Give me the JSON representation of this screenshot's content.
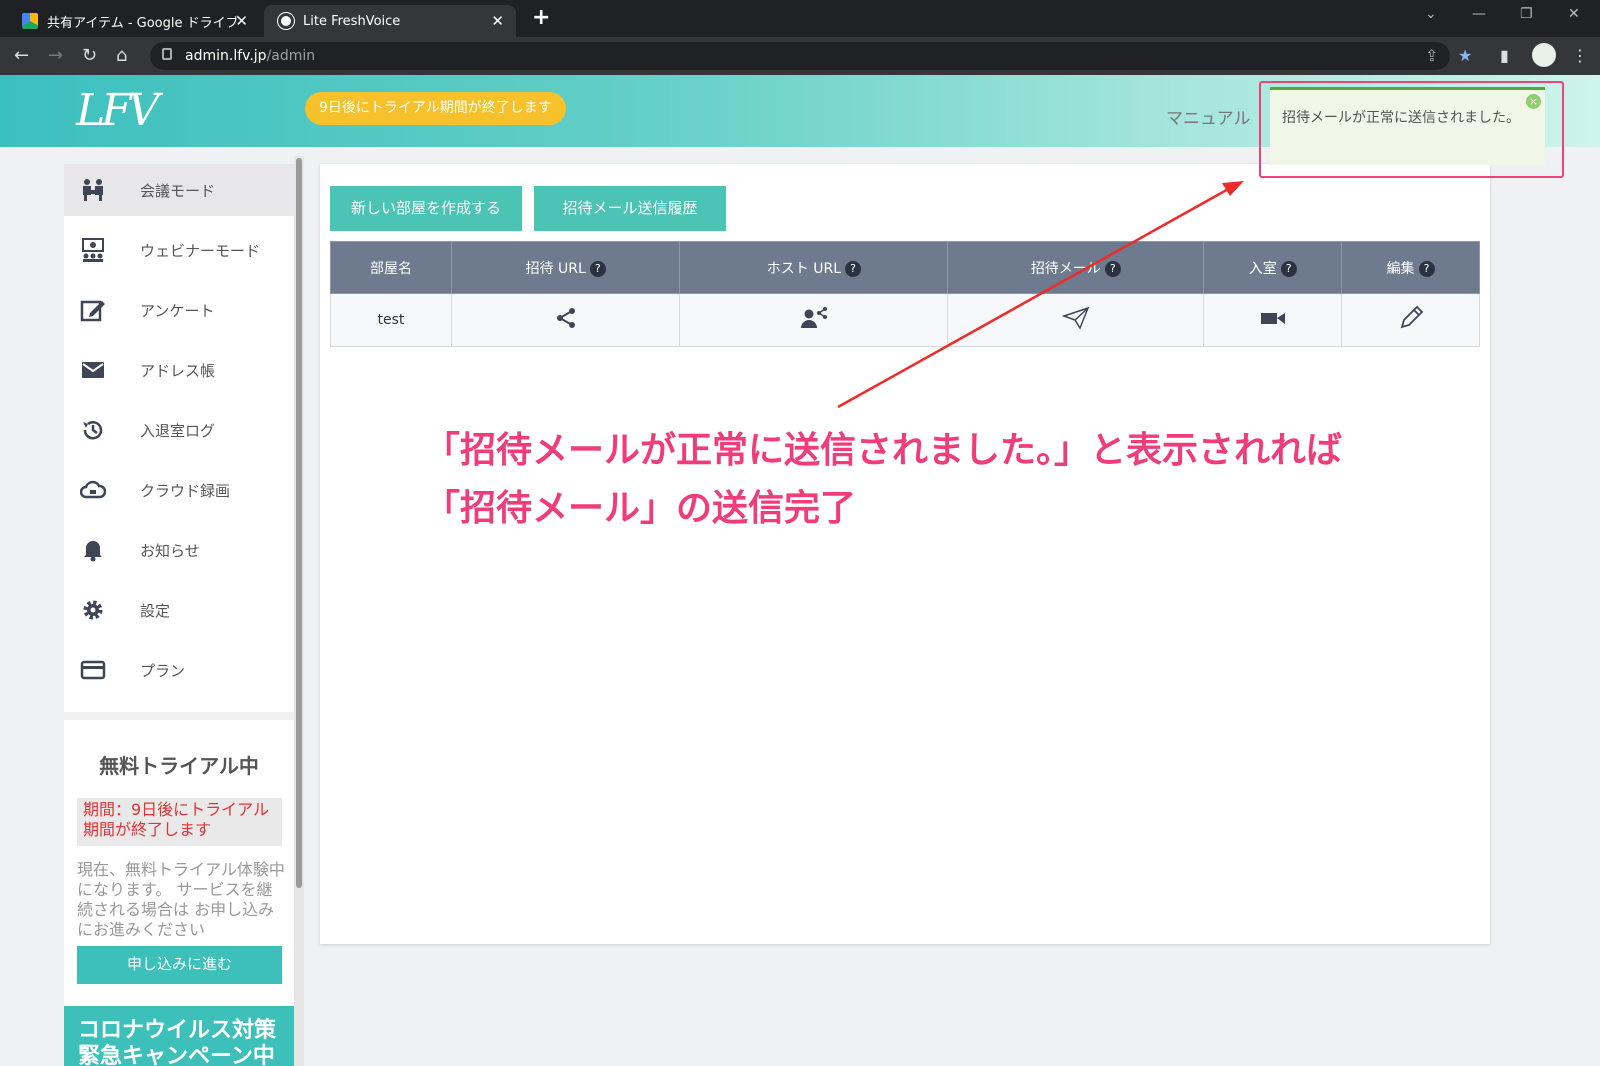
{
  "browser": {
    "tabs": [
      {
        "title": "共有アイテム - Google ドライブ",
        "active": false
      },
      {
        "title": "Lite FreshVoice",
        "active": true
      }
    ],
    "url_host": "admin.lfv.jp",
    "url_path": "/admin",
    "new_tab": "+",
    "close_glyph": "✕"
  },
  "header": {
    "logo": "LFV",
    "trial_notice": "9日後にトライアル期間が終了します",
    "manual_link": "マニュアル"
  },
  "sidebar": {
    "items": [
      {
        "label": "会議モード",
        "icon": "meeting-icon",
        "active": true
      },
      {
        "label": "ウェビナーモード",
        "icon": "webinar-icon",
        "active": false
      },
      {
        "label": "アンケート",
        "icon": "survey-edit-icon",
        "active": false
      },
      {
        "label": "アドレス帳",
        "icon": "envelope-icon",
        "active": false
      },
      {
        "label": "入退室ログ",
        "icon": "history-icon",
        "active": false
      },
      {
        "label": "クラウド録画",
        "icon": "cloud-icon",
        "active": false
      },
      {
        "label": "お知らせ",
        "icon": "bell-icon",
        "active": false
      },
      {
        "label": "設定",
        "icon": "gear-icon",
        "active": false
      },
      {
        "label": "プラン",
        "icon": "credit-card-icon",
        "active": false
      }
    ],
    "trial": {
      "title": "無料トライアル中",
      "period": "期間：9日後にトライアル期間が終了します",
      "description": "現在、無料トライアル体験中 になります。 サービスを継続される場合は お申し込みにお進みください",
      "apply_button": "申し込みに進む"
    },
    "campaign": "コロナウイルス対策緊急キャンペーン中"
  },
  "main": {
    "create_room_button": "新しい部屋を作成する",
    "invite_history_button": "招待メール送信履歴",
    "table": {
      "columns": [
        "部屋名",
        "招待 URL",
        "ホスト URL",
        "招待メール",
        "入室",
        "編集"
      ],
      "help_glyph": "?",
      "rows": [
        {
          "room_name": "test"
        }
      ]
    }
  },
  "toast": {
    "message": "招待メールが正常に送信されました。",
    "close_glyph": "×"
  },
  "annotation": {
    "line1": "「招待メールが正常に送信されました。」と表示されれば",
    "line2": "「招待メール」の送信完了"
  },
  "colors": {
    "accent": "#3dc0b9",
    "table_header": "#6e7b8e",
    "trial_pill": "#f7c12b",
    "annotation": "#f03c7a",
    "toast_border": "#5aa33e"
  }
}
